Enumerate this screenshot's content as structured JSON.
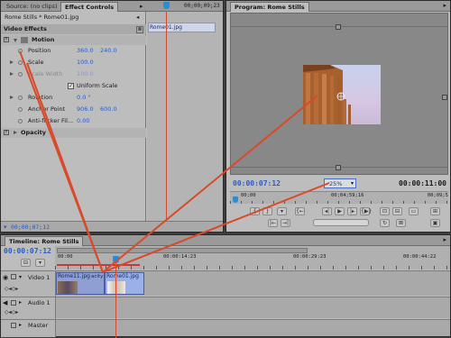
{
  "effect_panel": {
    "tabs": [
      "Source: (no clips)",
      "Effect Controls"
    ],
    "sequence_clip": "Rome Stills * Rome01.jpg",
    "mini_timecode": "00;00;09;23",
    "mini_clip_label": "Rome01.jpg",
    "section_title": "Video Effects",
    "motion_label": "Motion",
    "properties": [
      {
        "label": "Position",
        "v1": "360.0",
        "v2": "240.0"
      },
      {
        "label": "Scale",
        "v1": "100.0",
        "v2": ""
      },
      {
        "label": "Scale Width",
        "v1": "100.0",
        "v2": ""
      },
      {
        "label": "Uniform Scale",
        "v1": "",
        "v2": ""
      },
      {
        "label": "Rotation",
        "v1": "0.0 °",
        "v2": ""
      },
      {
        "label": "Anchor Point",
        "v1": "906.0",
        "v2": "600.0"
      },
      {
        "label": "Anti-flicker Fil...",
        "v1": "0.00",
        "v2": ""
      }
    ],
    "opacity_label": "Opacity",
    "bottom_timecode": "00;00;07;12"
  },
  "program_panel": {
    "tab": "Program: Rome Stills",
    "timecode": "00:00:07:12",
    "zoom": "25%",
    "duration": "00:00:11:00",
    "ruler_start": "00;00",
    "ruler_mid": "00;04;59;16",
    "ruler_end": "00;09;5"
  },
  "timeline_panel": {
    "tab": "Timeline: Rome Stills",
    "timecode": "00:00:07:12",
    "ruler_labels": [
      "00:00",
      "00:00:14:23",
      "00:00:29:23",
      "00:00:44:22"
    ],
    "tracks": [
      {
        "name": "Video 1"
      },
      {
        "name": "Audio 1"
      },
      {
        "name": "Master"
      }
    ],
    "clips": [
      {
        "label": "Rome11.jpg",
        "suffix": "acity"
      },
      {
        "label": "Rome01.jpg",
        "suffix": ""
      }
    ]
  },
  "colors": {
    "panel_bg": "#bdbdbd",
    "callout_red": "#d94a2a",
    "value_blue": "#2b5cc4",
    "clip_blue": "#8f9fd4",
    "playhead": "#2b8cd6"
  }
}
